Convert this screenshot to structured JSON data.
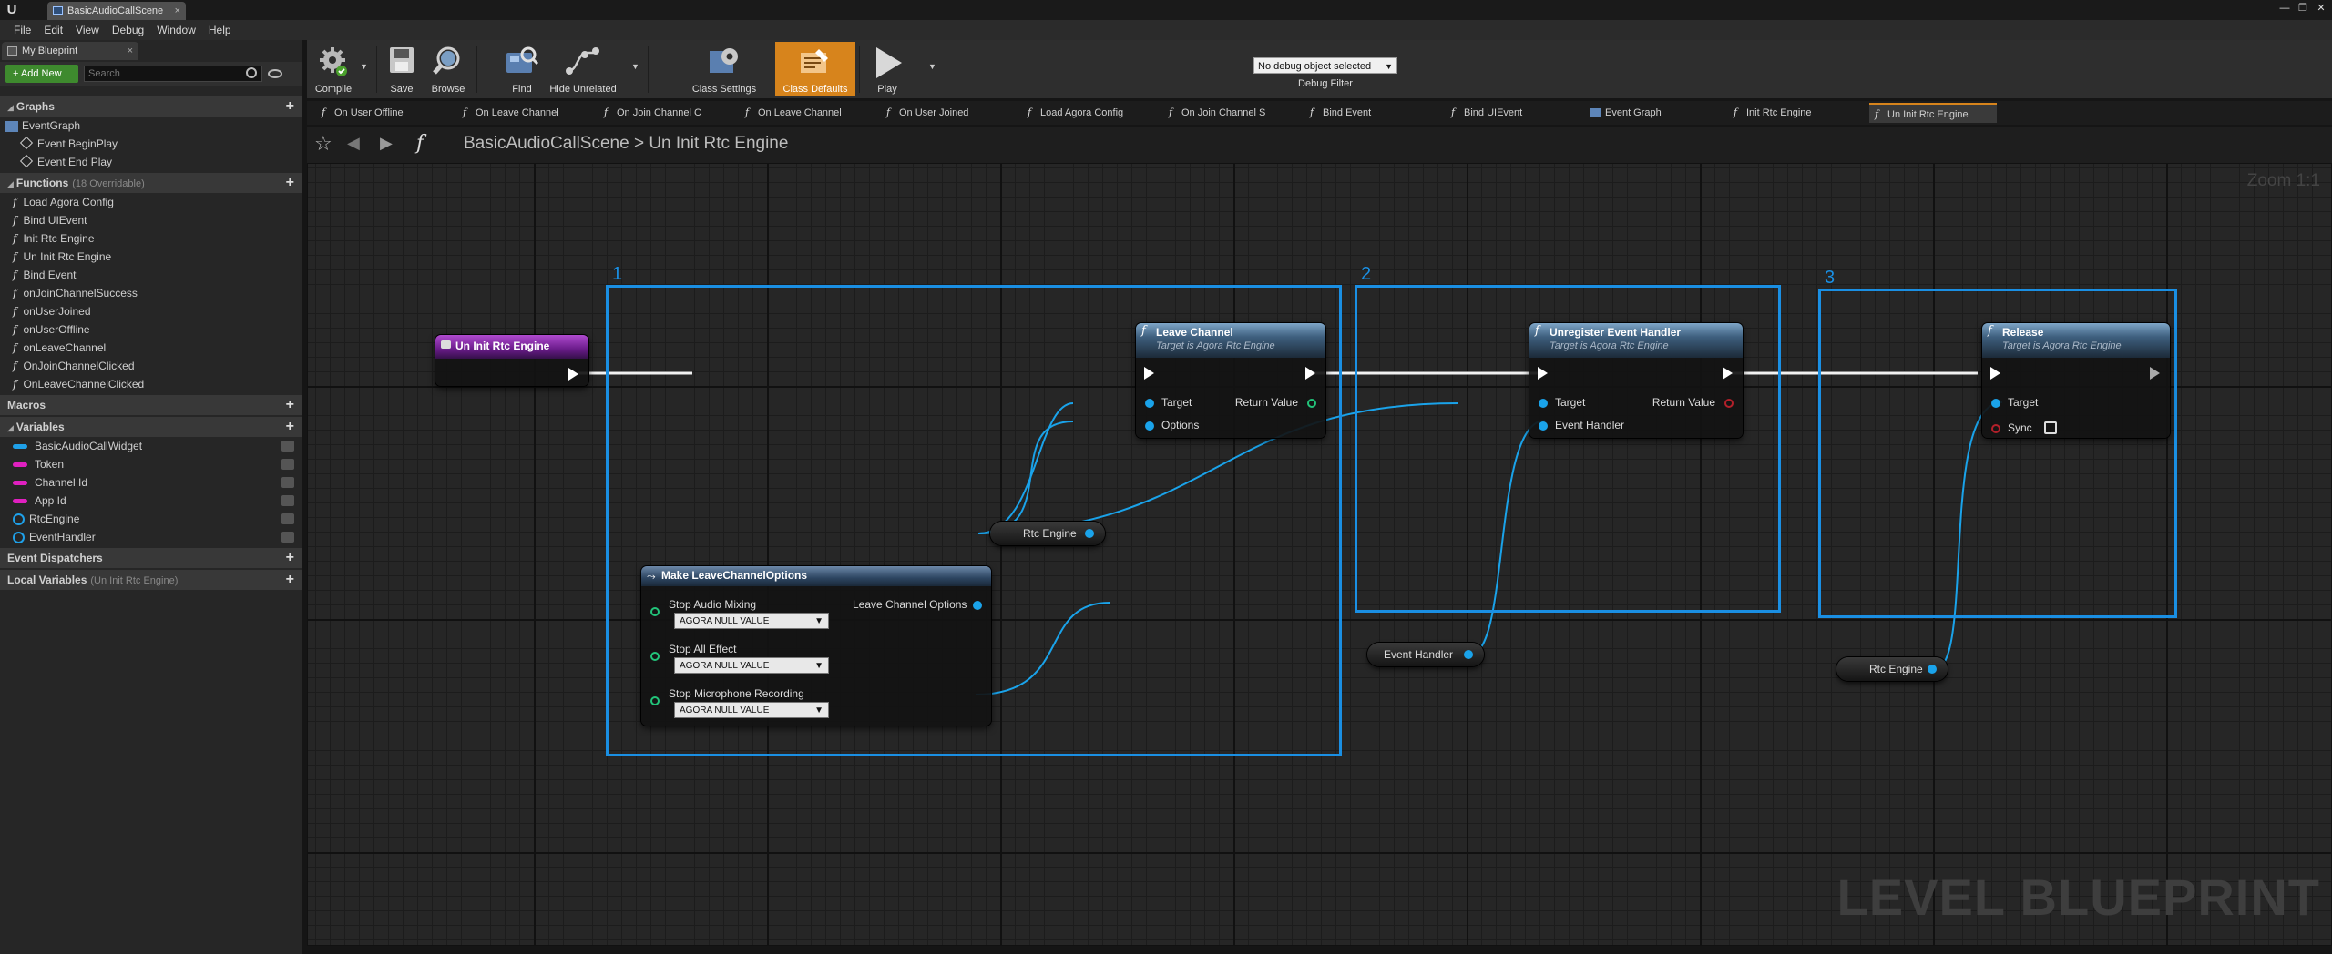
{
  "window": {
    "logo": "U",
    "tab_title": "BasicAudioCallScene",
    "controls": [
      "—",
      "❐",
      "✕"
    ]
  },
  "menu": [
    "File",
    "Edit",
    "View",
    "Debug",
    "Window",
    "Help"
  ],
  "left_panel": {
    "tab_label": "My Blueprint",
    "add_new_label": "+ Add New",
    "search_placeholder": "Search",
    "graphs_header": "Graphs",
    "event_graph": "EventGraph",
    "events": [
      "Event BeginPlay",
      "Event End Play"
    ],
    "functions_header": "Functions",
    "functions_sub": "(18 Overridable)",
    "functions": [
      "Load Agora Config",
      "Bind UIEvent",
      "Init Rtc Engine",
      "Un Init Rtc Engine",
      "Bind Event",
      "onJoinChannelSuccess",
      "onUserJoined",
      "onUserOffline",
      "onLeaveChannel",
      "OnJoinChannelClicked",
      "OnLeaveChannelClicked"
    ],
    "macros_header": "Macros",
    "variables_header": "Variables",
    "variables": [
      {
        "name": "BasicAudioCallWidget",
        "color": "#1fa0e8",
        "kind": "widget"
      },
      {
        "name": "Token",
        "color": "#e020c0",
        "kind": "string"
      },
      {
        "name": "Channel Id",
        "color": "#e020c0",
        "kind": "string"
      },
      {
        "name": "App Id",
        "color": "#e020c0",
        "kind": "string"
      },
      {
        "name": "RtcEngine",
        "color": "#1fa0e8",
        "kind": "object"
      },
      {
        "name": "EventHandler",
        "color": "#1fa0e8",
        "kind": "object"
      }
    ],
    "dispatchers_header": "Event Dispatchers",
    "local_vars_header": "Local Variables",
    "local_vars_sub": "(Un Init Rtc Engine)"
  },
  "toolbar": {
    "compile": "Compile",
    "save": "Save",
    "browse": "Browse",
    "find": "Find",
    "hide_unrelated": "Hide Unrelated",
    "class_settings": "Class Settings",
    "class_defaults": "Class Defaults",
    "play": "Play",
    "debug_select": "No debug object selected",
    "debug_filter": "Debug Filter"
  },
  "graph_tabs": [
    {
      "label": "On User Offline",
      "type": "function"
    },
    {
      "label": "On Leave Channel",
      "type": "function"
    },
    {
      "label": "On Join Channel C",
      "type": "function"
    },
    {
      "label": "On Leave Channel",
      "type": "function"
    },
    {
      "label": "On User Joined",
      "type": "function"
    },
    {
      "label": "Load Agora Config",
      "type": "function"
    },
    {
      "label": "On Join Channel S",
      "type": "function"
    },
    {
      "label": "Bind Event",
      "type": "function"
    },
    {
      "label": "Bind UIEvent",
      "type": "function"
    },
    {
      "label": "Event Graph",
      "type": "graph"
    },
    {
      "label": "Init Rtc Engine",
      "type": "function"
    },
    {
      "label": "Un Init Rtc Engine",
      "type": "function",
      "active": true
    }
  ],
  "breadcrumb": "BasicAudioCallScene > Un Init Rtc Engine",
  "graph": {
    "zoom": "Zoom 1:1",
    "watermark": "LEVEL BLUEPRINT",
    "comments": [
      "1",
      "2",
      "3"
    ],
    "entry_node": "Un Init Rtc Engine",
    "leave_channel": {
      "title": "Leave Channel",
      "subtitle": "Target is Agora Rtc Engine",
      "target": "Target",
      "options": "Options",
      "return": "Return Value"
    },
    "unregister": {
      "title": "Unregister Event Handler",
      "subtitle": "Target is Agora Rtc Engine",
      "target": "Target",
      "handler": "Event Handler",
      "return": "Return Value"
    },
    "release": {
      "title": "Release",
      "subtitle": "Target is Agora Rtc Engine",
      "target": "Target",
      "sync": "Sync"
    },
    "make_options": {
      "title": "Make LeaveChannelOptions",
      "output": "Leave Channel Options",
      "fields": [
        {
          "label": "Stop Audio Mixing",
          "value": "AGORA NULL VALUE"
        },
        {
          "label": "Stop All Effect",
          "value": "AGORA NULL VALUE"
        },
        {
          "label": "Stop Microphone Recording",
          "value": "AGORA NULL VALUE"
        }
      ]
    },
    "var_rtc_engine_1": "Rtc Engine",
    "var_event_handler": "Event Handler",
    "var_rtc_engine_2": "Rtc Engine"
  }
}
